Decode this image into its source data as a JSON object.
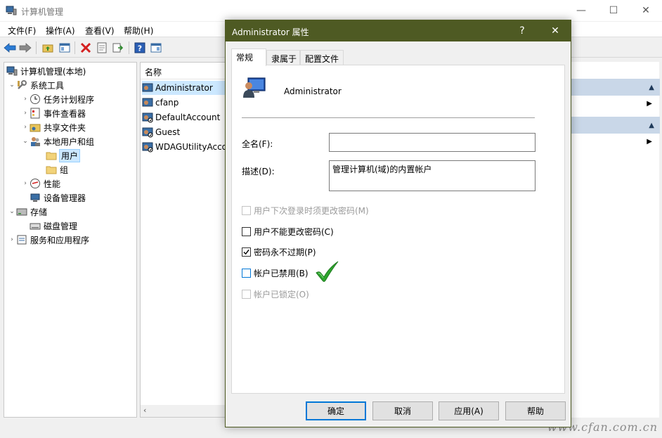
{
  "main": {
    "title": "计算机管理",
    "menu": [
      "文件(F)",
      "操作(A)",
      "查看(V)",
      "帮助(H)"
    ],
    "tree": [
      {
        "label": "计算机管理(本地)",
        "level": 0,
        "arrow": "",
        "icon": "computer-management-icon"
      },
      {
        "label": "系统工具",
        "level": 1,
        "arrow": "v",
        "icon": "tools-icon"
      },
      {
        "label": "任务计划程序",
        "level": 2,
        "arrow": ">",
        "icon": "clock-icon"
      },
      {
        "label": "事件查看器",
        "level": 2,
        "arrow": ">",
        "icon": "event-viewer-icon"
      },
      {
        "label": "共享文件夹",
        "level": 2,
        "arrow": ">",
        "icon": "shared-folder-icon"
      },
      {
        "label": "本地用户和组",
        "level": 2,
        "arrow": "v",
        "icon": "users-icon"
      },
      {
        "label": "用户",
        "level": 3,
        "arrow": "",
        "icon": "folder-icon"
      },
      {
        "label": "组",
        "level": 3,
        "arrow": "",
        "icon": "folder-icon"
      },
      {
        "label": "性能",
        "level": 2,
        "arrow": ">",
        "icon": "performance-icon"
      },
      {
        "label": "设备管理器",
        "level": 2,
        "arrow": "",
        "icon": "device-manager-icon"
      },
      {
        "label": "存储",
        "level": 1,
        "arrow": "v",
        "icon": "storage-icon"
      },
      {
        "label": "磁盘管理",
        "level": 2,
        "arrow": "",
        "icon": "disk-icon"
      },
      {
        "label": "服务和应用程序",
        "level": 1,
        "arrow": ">",
        "icon": "services-icon"
      }
    ],
    "list_header": "名称",
    "list_items": [
      "Administrator",
      "cfanp",
      "DefaultAccount",
      "Guest",
      "WDAGUtilityAccount"
    ]
  },
  "dialog": {
    "title": "Administrator 属性",
    "help_glyph": "?",
    "close_glyph": "✕",
    "tabs": [
      "常规",
      "隶属于",
      "配置文件"
    ],
    "username": "Administrator",
    "fullname_label": "全名(F):",
    "fullname_value": "",
    "description_label": "描述(D):",
    "description_value": "管理计算机(域)的内置帐户",
    "options": [
      {
        "label": "用户下次登录时须更改密码(M)",
        "checked": false,
        "enabled": false
      },
      {
        "label": "用户不能更改密码(C)",
        "checked": false,
        "enabled": true
      },
      {
        "label": "密码永不过期(P)",
        "checked": true,
        "enabled": true
      },
      {
        "label": "帐户已禁用(B)",
        "checked": false,
        "enabled": true
      },
      {
        "label": "帐户已锁定(O)",
        "checked": false,
        "enabled": false
      }
    ],
    "buttons": {
      "ok": "确定",
      "cancel": "取消",
      "apply": "应用(A)",
      "help": "帮助"
    }
  },
  "watermark": "www.cfan.com.cn",
  "colors": {
    "dialog_titlebar": "#4e5a23",
    "accent": "#0078d7",
    "selection": "#cce8ff",
    "check_green": "#2ea52e"
  }
}
